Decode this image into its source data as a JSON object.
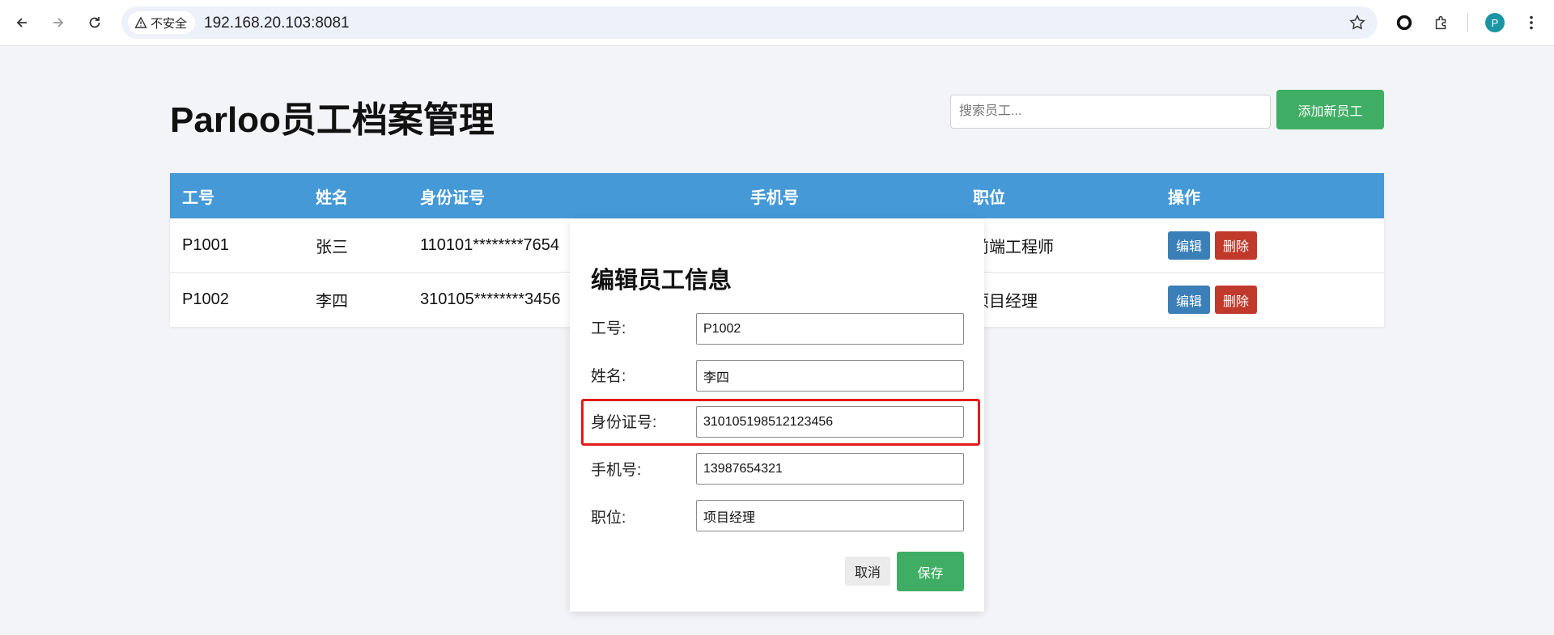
{
  "browser": {
    "security_label": "不安全",
    "url": "192.168.20.103:8081",
    "profile_initial": "P"
  },
  "page": {
    "title": "Parloo员工档案管理",
    "search_placeholder": "搜索员工...",
    "add_button": "添加新员工"
  },
  "table": {
    "headers": [
      "工号",
      "姓名",
      "身份证号",
      "手机号",
      "职位",
      "操作"
    ],
    "rows": [
      {
        "id": "P1001",
        "name": "张三",
        "id_card": "110101********7654",
        "phone": "",
        "position": "前端工程师",
        "edit": "编辑",
        "delete": "删除"
      },
      {
        "id": "P1002",
        "name": "李四",
        "id_card": "310105********3456",
        "phone": "",
        "position": "项目经理",
        "edit": "编辑",
        "delete": "删除"
      }
    ]
  },
  "modal": {
    "title": "编辑员工信息",
    "fields": [
      {
        "label": "工号:",
        "value": "P1002"
      },
      {
        "label": "姓名:",
        "value": "李四"
      },
      {
        "label": "身份证号:",
        "value": "310105198512123456"
      },
      {
        "label": "手机号:",
        "value": "13987654321"
      },
      {
        "label": "职位:",
        "value": "项目经理"
      }
    ],
    "cancel": "取消",
    "save": "保存"
  },
  "colors": {
    "header_blue": "#4599d7",
    "green": "#3fae64",
    "edit_blue": "#3a7fb8",
    "delete_red": "#c0392b",
    "highlight_red": "#e21b1b"
  }
}
